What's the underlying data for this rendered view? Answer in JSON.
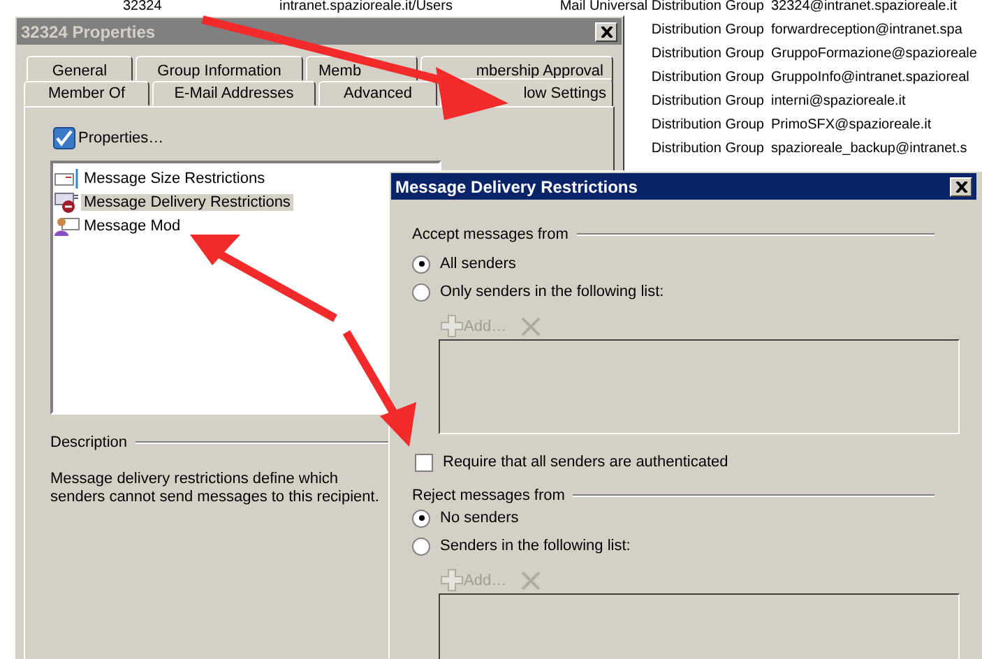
{
  "background_list": {
    "rows": [
      {
        "name": "32324",
        "location": "intranet.spazioreale.it/Users",
        "type": "Mail Universal Distribution Group",
        "email": "32324@intranet.spazioreale.it"
      },
      {
        "type": "Distribution Group",
        "email": "forwardreception@intranet.spa"
      },
      {
        "type": "Distribution Group",
        "email": "GruppoFormazione@spazioreale"
      },
      {
        "type": "Distribution Group",
        "email": "GruppoInfo@intranet.spazioreal"
      },
      {
        "type": "Distribution Group",
        "email": "interni@spazioreale.it"
      },
      {
        "type": "Distribution Group",
        "email": "PrimoSFX@spazioreale.it"
      },
      {
        "type": "Distribution Group",
        "email": "spazioreale_backup@intranet.s"
      }
    ]
  },
  "properties_window": {
    "title": "32324 Properties",
    "tabs_back": [
      {
        "label": "General",
        "selected": false
      },
      {
        "label": "Group Information",
        "selected": false
      },
      {
        "label": "Memb",
        "selected": false
      },
      {
        "label": "mbership Approval",
        "selected": false
      }
    ],
    "tabs_front": [
      {
        "label": "Member Of",
        "selected": false
      },
      {
        "label": "E-Mail Addresses",
        "selected": false
      },
      {
        "label": "Advanced",
        "selected": false
      },
      {
        "label": "low Settings",
        "selected": true
      }
    ],
    "properties_button": "Properties…",
    "features": [
      {
        "label": "Message Size Restrictions",
        "kind": "size",
        "selected": false
      },
      {
        "label": "Message Delivery Restrictions",
        "kind": "delivery",
        "selected": true
      },
      {
        "label": "Message Mod",
        "kind": "moderation",
        "selected": false
      }
    ],
    "description": {
      "heading": "Description",
      "text": "Message delivery restrictions define which senders cannot send messages to this recipient."
    }
  },
  "dialog": {
    "title": "Message Delivery Restrictions",
    "accept": {
      "heading": "Accept messages from",
      "options": [
        {
          "label": "All senders",
          "selected": true
        },
        {
          "label": "Only senders in the following list:",
          "selected": false
        }
      ],
      "add_label": "Add…",
      "disabled": true
    },
    "require_auth": {
      "label": "Require that all senders are authenticated",
      "checked": false
    },
    "reject": {
      "heading": "Reject messages from",
      "options": [
        {
          "label": "No senders",
          "selected": true
        },
        {
          "label": "Senders in the following list:",
          "selected": false
        }
      ],
      "add_label": "Add…",
      "disabled": true
    }
  }
}
